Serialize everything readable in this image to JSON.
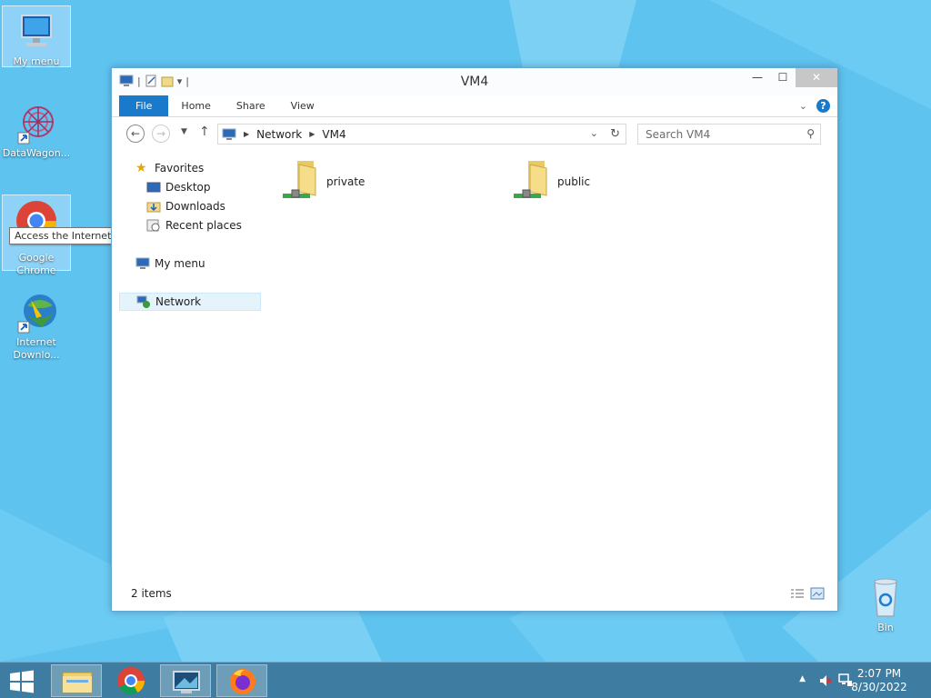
{
  "desktop": {
    "icons": [
      {
        "label": "My menu"
      },
      {
        "label": "DataWagon..."
      },
      {
        "label": "Google Chrome"
      },
      {
        "label": "Internet Downlo..."
      },
      {
        "label": "Bin"
      }
    ],
    "tooltip": "Access the Internet"
  },
  "window": {
    "title": "VM4",
    "ribbon_tabs": [
      "File",
      "Home",
      "Share",
      "View"
    ],
    "address": {
      "segments": [
        "Network",
        "VM4"
      ]
    },
    "search_placeholder": "Search VM4",
    "nav": {
      "favorites": "Favorites",
      "desktop": "Desktop",
      "downloads": "Downloads",
      "recent": "Recent places",
      "mymenu": "My menu",
      "network": "Network"
    },
    "folders": [
      {
        "name": "private"
      },
      {
        "name": "public"
      }
    ],
    "status": "2 items"
  },
  "taskbar": {
    "time": "2:07 PM",
    "date": "8/30/2022"
  },
  "colors": {
    "accent": "#1979ca",
    "desktop": "#5fc3f0",
    "taskbar": "#3e7da1"
  }
}
